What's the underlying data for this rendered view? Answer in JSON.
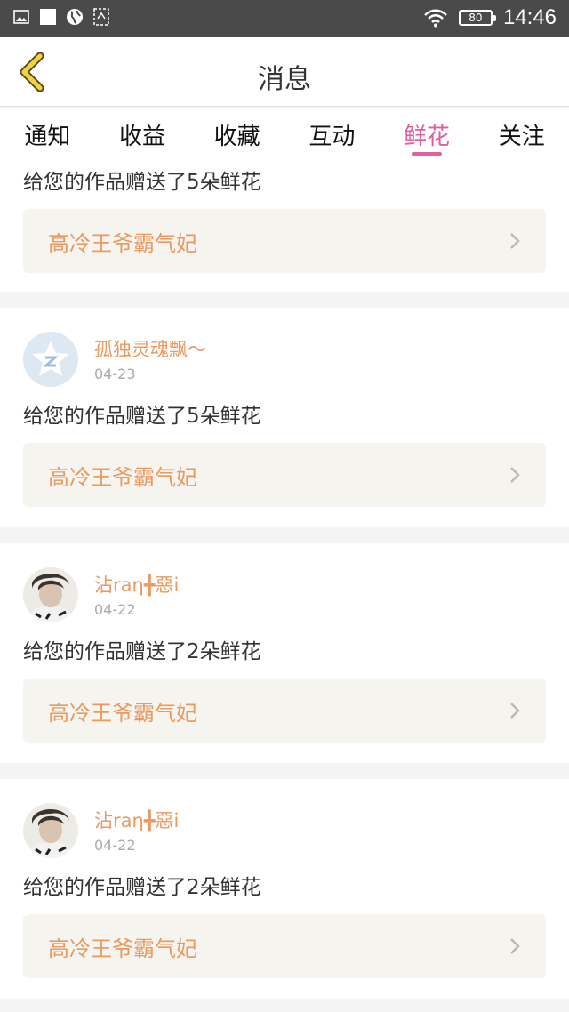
{
  "status_bar": {
    "left_icons": [
      "image-icon",
      "square-icon",
      "globe-icon",
      "screenshot-icon"
    ],
    "battery": "80",
    "time": "14:46"
  },
  "header": {
    "title": "消息"
  },
  "tabs": [
    {
      "label": "通知",
      "active": false
    },
    {
      "label": "收益",
      "active": false
    },
    {
      "label": "收藏",
      "active": false
    },
    {
      "label": "互动",
      "active": false
    },
    {
      "label": "鲜花",
      "active": true
    },
    {
      "label": "关注",
      "active": false
    }
  ],
  "colors": {
    "accent": "#e0609c",
    "name": "#e99a62",
    "work_bg": "#f5f4ee",
    "status_bar": "#4a4a4a"
  },
  "messages": [
    {
      "text": "给您的作品赠送了5朵鲜花",
      "work": "高冷王爷霸气妃"
    },
    {
      "user": "孤独灵魂飘〜",
      "date": "04-23",
      "avatar": "qq-avatar",
      "text": "给您的作品赠送了5朵鲜花",
      "work": "高冷王爷霸气妃"
    },
    {
      "user": "沾rаη╋惡ⅰ",
      "date": "04-22",
      "avatar": "photo-avatar",
      "text": "给您的作品赠送了2朵鲜花",
      "work": "高冷王爷霸气妃"
    },
    {
      "user": "沾rаη╋惡ⅰ",
      "date": "04-22",
      "avatar": "photo-avatar",
      "text": "给您的作品赠送了2朵鲜花",
      "work": "高冷王爷霸气妃"
    }
  ]
}
